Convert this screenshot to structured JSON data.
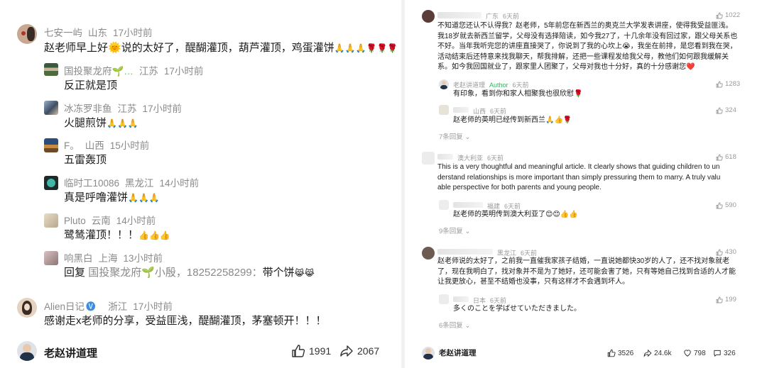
{
  "left": {
    "main_comment": {
      "username": "七安一屿",
      "location": "山东",
      "time": "17小时前",
      "text_a": "赵老师早上好",
      "text_b": "说的太好了，醍醐灌顶，葫芦灌顶，鸡蛋灌饼",
      "emojis": "🙏🙏🙏🌹🌹🌹"
    },
    "replies": [
      {
        "username": "国投聚龙府",
        "location": "江苏",
        "time": "17小时前",
        "text": "反正就是顶",
        "emojis": ""
      },
      {
        "username": "冰冻罗非鱼",
        "location": "江苏",
        "time": "17小时前",
        "text": "火腿煎饼",
        "emojis": "🙏🙏🙏"
      },
      {
        "username": "F。",
        "location": "山西",
        "time": "15小时前",
        "text": "五雷轰顶",
        "emojis": ""
      },
      {
        "username": "临时工10086",
        "location": "黑龙江",
        "time": "14小时前",
        "text": "真是呼噜灌饼",
        "emojis": "🙏🙏🙏"
      },
      {
        "username": "Pluto",
        "location": "云南",
        "time": "14小时前",
        "text": "鹭鸶灌顶！！！",
        "emojis": "👍👍👍"
      },
      {
        "username": "响黑白",
        "location": "上海",
        "time": "13小时前",
        "text": "回复",
        "quote": "国投聚龙府",
        "quote2": "小殷，18252258299：",
        "text2": "带个饼",
        "emojis": "😹😹"
      }
    ],
    "second_comment": {
      "username": "Alien日记",
      "location": "浙江",
      "time": "17小时前",
      "text": "感谢走x老师的分享，受益匪浅，醍醐灌顶，茅塞顿开！！！"
    },
    "footer": {
      "author": "老赵讲道理",
      "likes": "1991",
      "shares": "2067"
    }
  },
  "right": {
    "comments": [
      {
        "location": "广东",
        "time": "6天前",
        "likes": "1022",
        "lines": [
          "不知道您还认不认得我？赵老师，5年前您在新西兰的奥克兰大学发表讲座，使得我受益匪浅。",
          "我18岁就去新西兰留学，父母没有选择陪读，如今我27了，十几余年没有回过家，跟父母关系也",
          "不好。当年我听完您的讲座直接哭了，你说到了我的心坎上😭，我坐在前排，是您看到我在哭，",
          "活动结束后还特意来找我聊天，帮我排解，还把一些课程发给我父母，教他们如何跟我缓解关",
          "系。如今我回国就业了，跟家里人团聚了，父母对我也十分好，真的十分感谢您❤️"
        ],
        "replies": [
          {
            "username": "老赵讲道理",
            "tag": "Author",
            "time": "6天前",
            "likes": "1283",
            "text": "有印象，看到你和家人相聚我也很欣慰🌹"
          },
          {
            "location": "山西",
            "time": "6天前",
            "likes": "324",
            "text": "赵老师的英明已经传到新西兰🙏👍🌹"
          }
        ],
        "more": "7条回复"
      },
      {
        "location": "澳大利亚",
        "time": "6天前",
        "likes": "618",
        "lines": [
          "This is a very thoughtful and meaningful article. It clearly shows that guiding children to un",
          "derstand relationships is more important than simply pressuring them to marry. A truly valu",
          "able perspective for both parents and young people."
        ],
        "replies": [
          {
            "location": "福建",
            "time": "6天前",
            "likes": "590",
            "text": "赵老师的英明传到澳大利亚了😊😊👍👍"
          }
        ],
        "more": "9条回复"
      },
      {
        "location": "黑龙江",
        "time": "6天前",
        "likes": "430",
        "lines": [
          "赵老师说的太好了，之前我一直催我家孩子结婚，一直说她都快30岁的人了，还不找对象就老",
          "了，现在我明白了，找对象并不是为了她好，还可能会害了她，只有等她自己找到合适的人才能",
          "让我更放心，甚至不结婚也没事，只有这样才不会遇到坏人。"
        ],
        "replies": [
          {
            "location": "日本",
            "time": "6天前",
            "likes": "199",
            "text": "多くのことを学ばせていただきました。"
          }
        ],
        "more": "6条回复"
      }
    ],
    "footer": {
      "author": "老赵讲道理",
      "likes": "3526",
      "shares": "24.6k",
      "favorites": "798",
      "comments": "326"
    }
  }
}
